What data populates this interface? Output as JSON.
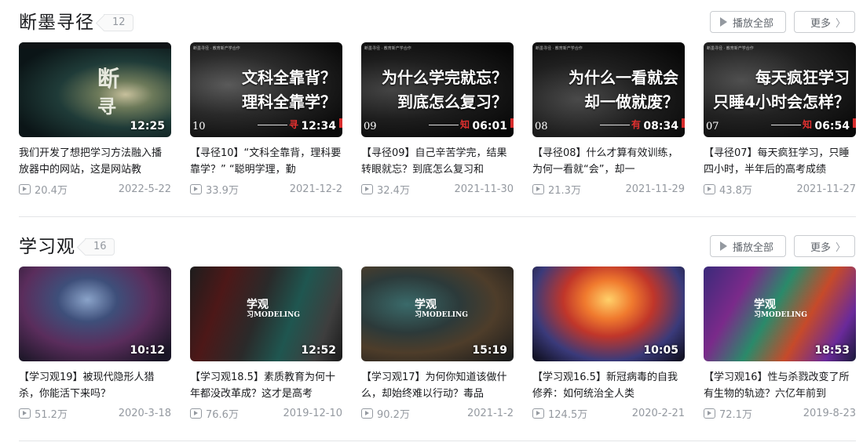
{
  "sections": [
    {
      "title": "断墨寻径",
      "count": "12",
      "play_all_label": "播放全部",
      "more_label": "更多",
      "videos": [
        {
          "duration": "12:25",
          "title": "我们开发了想把学习方法融入播放器中的网站，这是网站教",
          "views": "20.4万",
          "date": "2022-5-22",
          "cover_text": "",
          "ep": "",
          "tag": ""
        },
        {
          "duration": "12:34",
          "title": "【寻径10】“文科全靠背，理科要靠学？” “聪明学理，勤",
          "views": "33.9万",
          "date": "2021-12-2",
          "cover_text": "文科全靠背？\n理科全靠学？",
          "ep": "10",
          "tag": "寻"
        },
        {
          "duration": "06:01",
          "title": "【寻径09】自己辛苦学完，结果转眼就忘？到底怎么复习和",
          "views": "32.4万",
          "date": "2021-11-30",
          "cover_text": "为什么学完就忘？\n到底怎么复习？",
          "ep": "09",
          "tag": "知"
        },
        {
          "duration": "08:34",
          "title": "【寻径08】什么才算有效训练，为何一看就“会”，却一",
          "views": "21.3万",
          "date": "2021-11-29",
          "cover_text": "为什么一看就会\n却一做就废？",
          "ep": "08",
          "tag": "有"
        },
        {
          "duration": "06:54",
          "title": "【寻径07】每天疯狂学习，只睡四小时，半年后的高考成绩",
          "views": "43.8万",
          "date": "2021-11-27",
          "cover_text": "每天疯狂学习\n只睡4小时会怎样？",
          "ep": "07",
          "tag": "知"
        }
      ]
    },
    {
      "title": "学习观",
      "count": "16",
      "play_all_label": "播放全部",
      "more_label": "更多",
      "videos": [
        {
          "duration": "10:12",
          "title": "【学习观19】被现代隐形人猎杀，你能活下来吗？",
          "views": "51.2万",
          "date": "2020-3-18",
          "cover_text": "",
          "ep": "",
          "tag": ""
        },
        {
          "duration": "12:52",
          "title": "【学习观18.5】素质教育为何十年都没改革成？这才是高考",
          "views": "76.6万",
          "date": "2019-12-10",
          "cover_text": "",
          "ep": "",
          "tag": ""
        },
        {
          "duration": "15:19",
          "title": "【学习观17】为何你知道该做什么，却始终难以行动？毒品",
          "views": "90.2万",
          "date": "2021-1-2",
          "cover_text": "",
          "ep": "",
          "tag": ""
        },
        {
          "duration": "10:05",
          "title": "【学习观16.5】新冠病毒的自我修养：如何统治全人类",
          "views": "124.5万",
          "date": "2020-2-21",
          "cover_text": "",
          "ep": "",
          "tag": ""
        },
        {
          "duration": "18:53",
          "title": "【学习观16】性与杀戮改变了所有生物的轨迹？六亿年前到",
          "views": "72.1万",
          "date": "2019-8-23",
          "cover_text": "",
          "ep": "",
          "tag": ""
        }
      ]
    }
  ],
  "cover_logos": {
    "first": {
      "big": "断",
      "small": "寻"
    },
    "series_logo": {
      "line1": "学观",
      "line2": "习MODELING"
    }
  },
  "cover_strip": "断墨寻径 · 教育新产学合作"
}
